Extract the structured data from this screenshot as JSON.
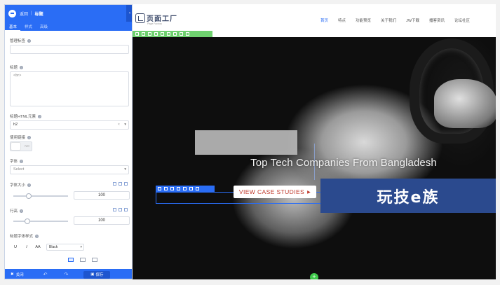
{
  "panel": {
    "back_label": "返回",
    "title": "标题",
    "tabs": [
      "基本",
      "样式",
      "高级"
    ],
    "fields": {
      "link_label": "管理标签",
      "title_label": "标题",
      "title_value": "<br>",
      "html_tag_label": "标题HTML元素",
      "html_tag_value": "h2",
      "toggle_label": "使用链接",
      "toggle_text": "NO",
      "font_label": "字体",
      "font_placeholder": "Select",
      "font_size_label": "字体大小",
      "font_size_value": "100",
      "line_height_label": "行高",
      "line_height_value": "100",
      "style_label": "标题字体样式",
      "style_underline": "U",
      "style_italic": "I",
      "style_case": "AA",
      "style_weight": "Black"
    },
    "footer": {
      "close_label": "关闭",
      "undo_icon": "↶",
      "redo_icon": "↷",
      "save_label": "保存"
    }
  },
  "site": {
    "logo_name": "页面工厂",
    "logo_sub": "Page Factory",
    "menu": [
      "首页",
      "特点",
      "功能预览",
      "关于我们",
      "JW下载",
      "播客资讯",
      "论坛社区"
    ],
    "hero_title": "Top Tech Companies From Bangladesh",
    "case_button": "VIEW CASE STUDIES",
    "badge": "玩技e族",
    "add_icon": "+"
  },
  "colors": {
    "accent": "#2a6df5",
    "selection_green": "#6fd16f",
    "button_text": "#c0392b",
    "badge_bg": "#2b4a8e"
  }
}
